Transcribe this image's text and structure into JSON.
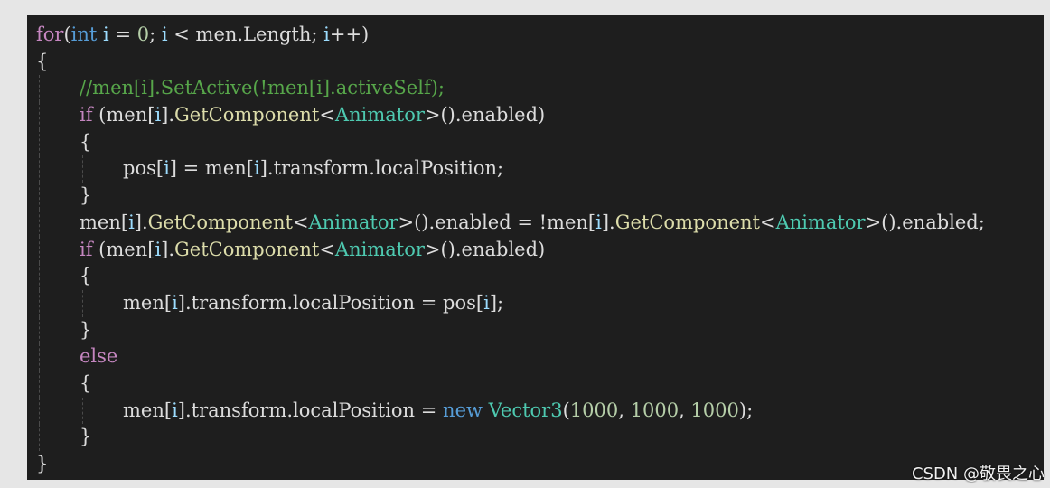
{
  "editor": {
    "lines": [
      {
        "indent": 0,
        "tokens": [
          {
            "t": "for",
            "k": "kw2"
          },
          {
            "t": "(",
            "k": "punct"
          },
          {
            "t": "int",
            "k": "kw"
          },
          {
            "t": " ",
            "k": "plain"
          },
          {
            "t": "i",
            "k": "var"
          },
          {
            "t": " = ",
            "k": "plain"
          },
          {
            "t": "0",
            "k": "num"
          },
          {
            "t": "; ",
            "k": "plain"
          },
          {
            "t": "i",
            "k": "var"
          },
          {
            "t": " < men.Length; ",
            "k": "plain"
          },
          {
            "t": "i",
            "k": "var"
          },
          {
            "t": "++)",
            "k": "plain"
          }
        ]
      },
      {
        "indent": 0,
        "tokens": [
          {
            "t": "{",
            "k": "plain"
          }
        ]
      },
      {
        "indent": 1,
        "tokens": [
          {
            "t": "//men[i].SetActive(!men[i].activeSelf);",
            "k": "cmt"
          }
        ]
      },
      {
        "indent": 1,
        "tokens": [
          {
            "t": "if",
            "k": "kw2"
          },
          {
            "t": " (men[",
            "k": "plain"
          },
          {
            "t": "i",
            "k": "var"
          },
          {
            "t": "].",
            "k": "plain"
          },
          {
            "t": "GetComponent",
            "k": "method"
          },
          {
            "t": "<",
            "k": "plain"
          },
          {
            "t": "Animator",
            "k": "type"
          },
          {
            "t": ">().enabled)",
            "k": "plain"
          }
        ]
      },
      {
        "indent": 1,
        "tokens": [
          {
            "t": "{",
            "k": "plain"
          }
        ]
      },
      {
        "indent": 2,
        "tokens": [
          {
            "t": "pos[",
            "k": "plain"
          },
          {
            "t": "i",
            "k": "var"
          },
          {
            "t": "] = men[",
            "k": "plain"
          },
          {
            "t": "i",
            "k": "var"
          },
          {
            "t": "].transform.localPosition;",
            "k": "plain"
          }
        ]
      },
      {
        "indent": 1,
        "tokens": [
          {
            "t": "}",
            "k": "plain"
          }
        ]
      },
      {
        "indent": 1,
        "tokens": [
          {
            "t": "men[",
            "k": "plain"
          },
          {
            "t": "i",
            "k": "var"
          },
          {
            "t": "].",
            "k": "plain"
          },
          {
            "t": "GetComponent",
            "k": "method"
          },
          {
            "t": "<",
            "k": "plain"
          },
          {
            "t": "Animator",
            "k": "type"
          },
          {
            "t": ">().enabled = !men[",
            "k": "plain"
          },
          {
            "t": "i",
            "k": "var"
          },
          {
            "t": "].",
            "k": "plain"
          },
          {
            "t": "GetComponent",
            "k": "method"
          },
          {
            "t": "<",
            "k": "plain"
          },
          {
            "t": "Animator",
            "k": "type"
          },
          {
            "t": ">().enabled;",
            "k": "plain"
          }
        ]
      },
      {
        "indent": 1,
        "tokens": [
          {
            "t": "if",
            "k": "kw2"
          },
          {
            "t": " (men[",
            "k": "plain"
          },
          {
            "t": "i",
            "k": "var"
          },
          {
            "t": "].",
            "k": "plain"
          },
          {
            "t": "GetComponent",
            "k": "method"
          },
          {
            "t": "<",
            "k": "plain"
          },
          {
            "t": "Animator",
            "k": "type"
          },
          {
            "t": ">().enabled)",
            "k": "plain"
          }
        ]
      },
      {
        "indent": 1,
        "tokens": [
          {
            "t": "{",
            "k": "plain"
          }
        ]
      },
      {
        "indent": 2,
        "tokens": [
          {
            "t": "men[",
            "k": "plain"
          },
          {
            "t": "i",
            "k": "var"
          },
          {
            "t": "].transform.localPosition = pos[",
            "k": "plain"
          },
          {
            "t": "i",
            "k": "var"
          },
          {
            "t": "];",
            "k": "plain"
          }
        ]
      },
      {
        "indent": 1,
        "tokens": [
          {
            "t": "}",
            "k": "plain"
          }
        ]
      },
      {
        "indent": 1,
        "tokens": [
          {
            "t": "else",
            "k": "kw2"
          }
        ]
      },
      {
        "indent": 1,
        "tokens": [
          {
            "t": "{",
            "k": "plain"
          }
        ]
      },
      {
        "indent": 2,
        "tokens": [
          {
            "t": "men[",
            "k": "plain"
          },
          {
            "t": "i",
            "k": "var"
          },
          {
            "t": "].transform.localPosition = ",
            "k": "plain"
          },
          {
            "t": "new",
            "k": "kw"
          },
          {
            "t": " ",
            "k": "plain"
          },
          {
            "t": "Vector3",
            "k": "type"
          },
          {
            "t": "(",
            "k": "plain"
          },
          {
            "t": "1000",
            "k": "num"
          },
          {
            "t": ", ",
            "k": "plain"
          },
          {
            "t": "1000",
            "k": "num"
          },
          {
            "t": ", ",
            "k": "plain"
          },
          {
            "t": "1000",
            "k": "num"
          },
          {
            "t": ");",
            "k": "plain"
          }
        ]
      },
      {
        "indent": 1,
        "tokens": [
          {
            "t": "}",
            "k": "plain"
          }
        ]
      },
      {
        "indent": 0,
        "tokens": [
          {
            "t": "}",
            "k": "plain"
          }
        ]
      }
    ]
  },
  "watermark": "CSDN @敬畏之心",
  "colors": {
    "background": "#1e1e1e",
    "keyword": "#569cd6",
    "control_keyword": "#c586c0",
    "comment": "#57a64a",
    "type": "#4ec9b0",
    "variable": "#9cdcfe",
    "method": "#dcdcaa",
    "plain": "#dcdcdc",
    "number": "#b5cea8"
  }
}
